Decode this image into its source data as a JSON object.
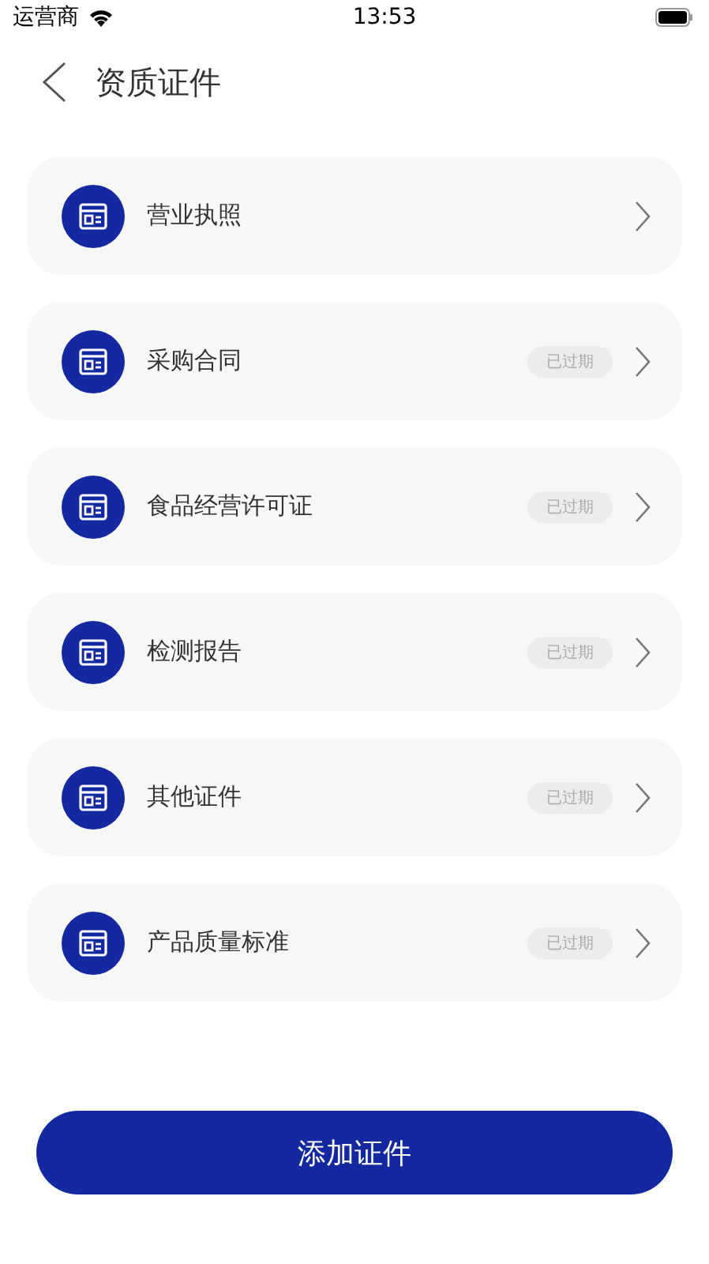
{
  "status_bar": {
    "carrier": "运营商",
    "time": "13:53"
  },
  "header": {
    "title": "资质证件"
  },
  "certificates": [
    {
      "name": "营业执照"
    },
    {
      "name": "采购合同",
      "badge": "已过期"
    },
    {
      "name": "食品经营许可证",
      "badge": "已过期"
    },
    {
      "name": "检测报告",
      "badge": "已过期"
    },
    {
      "name": "其他证件",
      "badge": "已过期"
    },
    {
      "name": "产品质量标准",
      "badge": "已过期"
    }
  ],
  "add_button": "添加证件"
}
